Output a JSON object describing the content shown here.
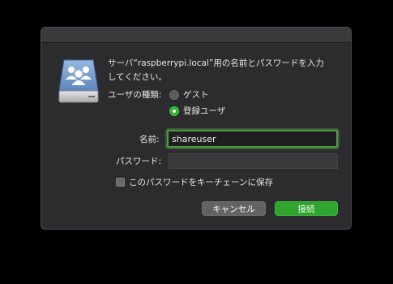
{
  "dialog": {
    "message": "サーバ“raspberrypi.local”用の名前とパスワードを入力\nしてください。",
    "usertype_label": "ユーザの種類:",
    "usertype_options": [
      {
        "label": "ゲスト",
        "selected": false
      },
      {
        "label": "登録ユーザ",
        "selected": true
      }
    ],
    "name_label": "名前:",
    "name_value": "shareuser",
    "password_label": "パスワード:",
    "password_value": "",
    "keychain_label": "このパスワードをキーチェーンに保存",
    "keychain_checked": false,
    "cancel_label": "キャンセル",
    "connect_label": "接続"
  },
  "icons": {
    "server": "network-server-users-icon"
  },
  "colors": {
    "accent": "#2fb12f",
    "focus_ring": "#4f9a45",
    "dialog_bg": "#2c2c2e"
  }
}
